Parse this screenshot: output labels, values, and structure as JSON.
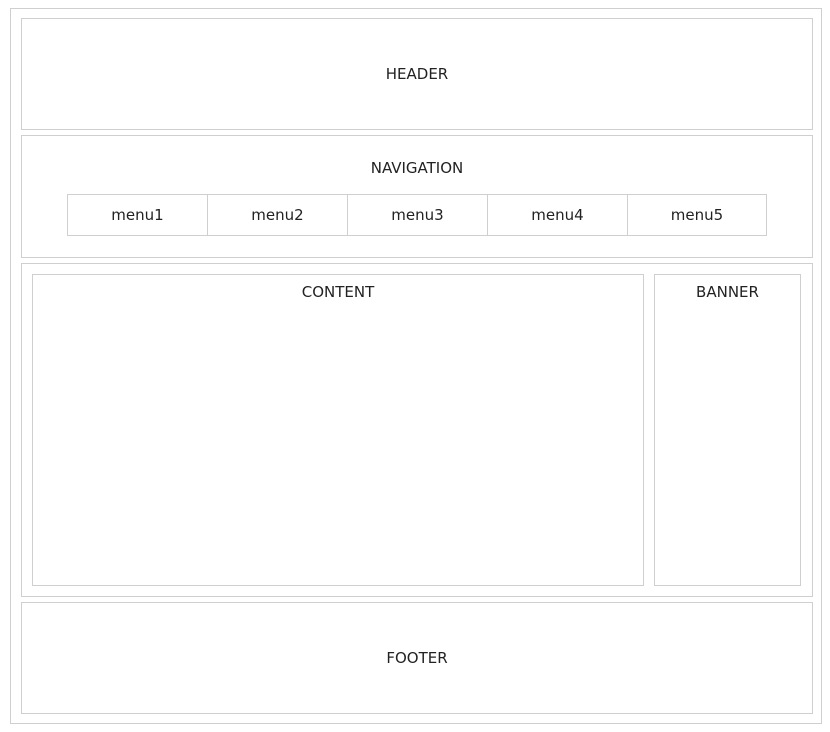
{
  "header": {
    "label": "HEADER"
  },
  "navigation": {
    "label": "NAVIGATION",
    "menus": [
      "menu1",
      "menu2",
      "menu3",
      "menu4",
      "menu5"
    ]
  },
  "content": {
    "label": "CONTENT"
  },
  "banner": {
    "label": "BANNER"
  },
  "footer": {
    "label": "FOOTER"
  }
}
